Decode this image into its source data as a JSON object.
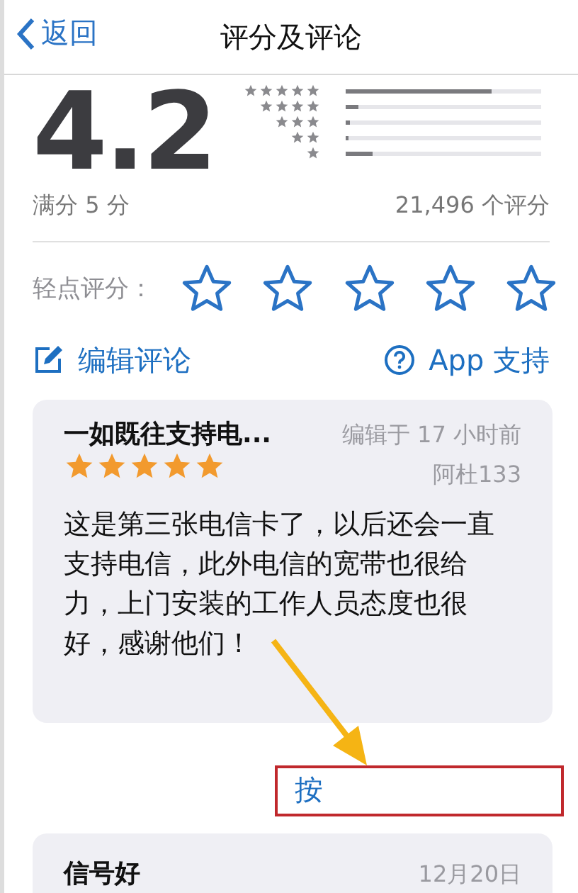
{
  "nav": {
    "back": "返回",
    "title": "评分及评论"
  },
  "summary": {
    "score": "4.2",
    "out_of": "满分 5 分",
    "count": "21,496 个评分",
    "histogram": [
      {
        "level": 0.75
      },
      {
        "level": 0.07
      },
      {
        "level": 0.025
      },
      {
        "level": 0.02
      },
      {
        "level": 0.14
      }
    ]
  },
  "tap_to_rate": {
    "label": "轻点评分："
  },
  "actions": [
    {
      "kind": "edit",
      "label": "编辑评论"
    },
    {
      "kind": "help",
      "label": "App 支持"
    }
  ],
  "reviews": [
    {
      "title": "一如既往支持电...",
      "date": "编辑于 17 小时前",
      "author": "阿杜133",
      "stars": 5,
      "body": "这是第三张电信卡了，以后还会一直支持电信，此外电信的宽带也很给力，上门安装的工作人员态度也很好，感谢他们！"
    },
    {
      "title": "信号好",
      "date": "12月20日"
    }
  ],
  "annotation": {
    "text": "按"
  }
}
